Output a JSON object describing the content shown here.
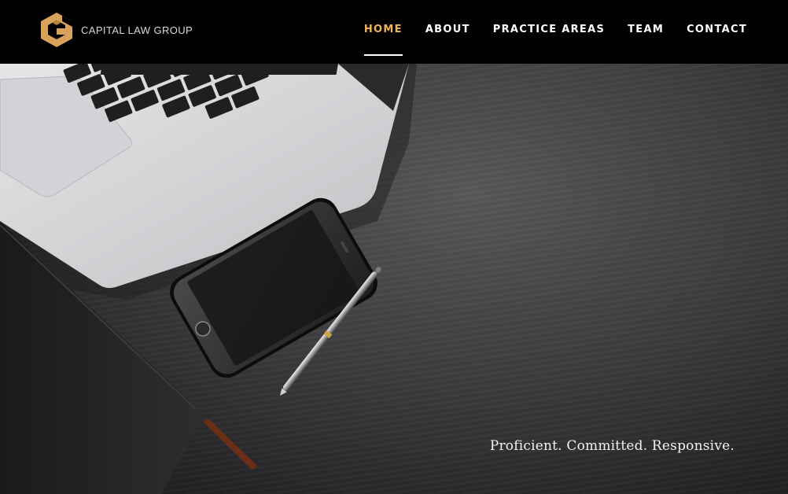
{
  "brand": {
    "name": "CAPITAL LAW GROUP",
    "logo_icon": "hexagon-g-logo",
    "accent_color": "#f0b45a"
  },
  "nav": {
    "items": [
      {
        "label": "HOME",
        "active": true
      },
      {
        "label": "ABOUT",
        "active": false
      },
      {
        "label": "PRACTICE AREAS",
        "active": false
      },
      {
        "label": "TEAM",
        "active": false
      },
      {
        "label": "CONTACT",
        "active": false
      }
    ]
  },
  "hero": {
    "tagline": "Proficient. Committed. Responsive."
  }
}
